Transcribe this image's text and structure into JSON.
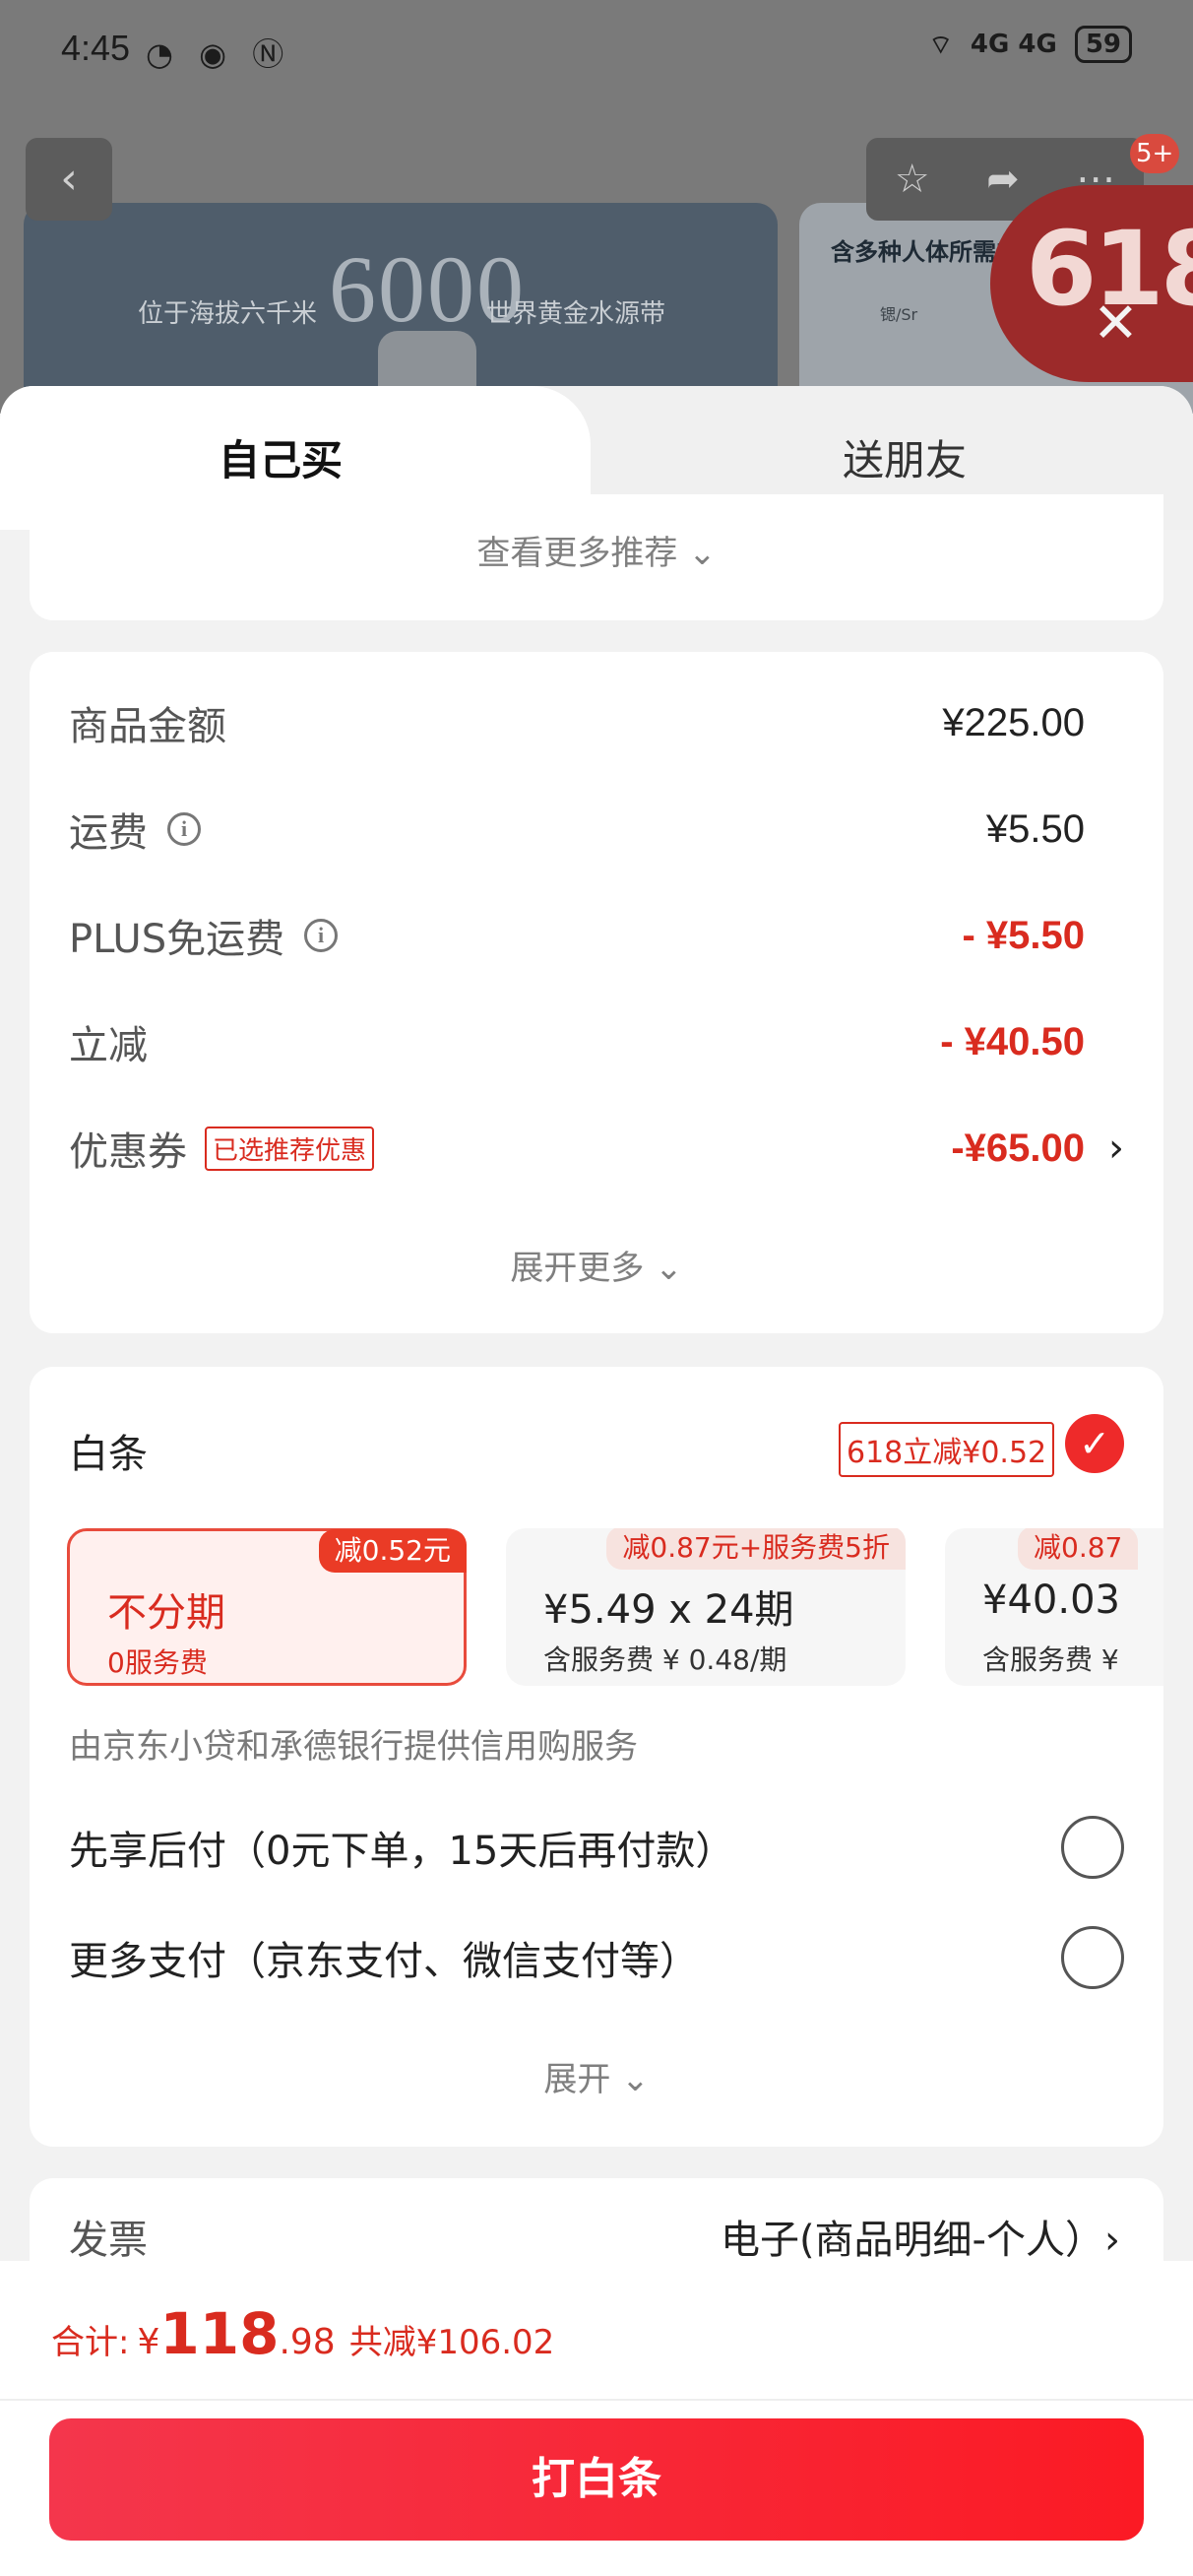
{
  "status_bar": {
    "time": "4:45",
    "network": "4G 4G",
    "battery": "59"
  },
  "background": {
    "banner_text_left": "位于海拔六千米",
    "banner_big_number": "6000",
    "banner_text_right": "世界黄金水源带",
    "card2_heading": "含多种人体所需的",
    "card2_mini": "锶/Sr",
    "message_badge": "5+",
    "promo_number": "618"
  },
  "tabs": {
    "self": "自己买",
    "friend": "送朋友"
  },
  "recommend": {
    "more_label": "查看更多推荐 ⌄"
  },
  "summary": {
    "rows": [
      {
        "label": "商品金额",
        "value": "¥225.00"
      },
      {
        "label": "运费",
        "value": "¥5.50"
      },
      {
        "label": "PLUS免运费",
        "value": "- ¥5.50"
      },
      {
        "label": "立减",
        "value": "- ¥40.50"
      },
      {
        "label": "优惠券",
        "tag": "已选推荐优惠",
        "value": "-¥65.00"
      }
    ],
    "expand_label": "展开更多 ⌄"
  },
  "payment": {
    "title": "白条",
    "promo_tag": "618立减¥0.52",
    "plans": [
      {
        "badge": "减0.52元",
        "title": "不分期",
        "sub": "0服务费"
      },
      {
        "badge": "减0.87元+服务费5折",
        "title": "¥5.49 x 24期",
        "sub": "含服务费 ¥ 0.48/期"
      },
      {
        "badge": "减0.87",
        "title": "¥40.03",
        "sub": "含服务费 ¥"
      }
    ],
    "provider_note": "由京东小贷和承德银行提供信用购服务",
    "options": [
      {
        "label": "先享后付（0元下单，15天后再付款）"
      },
      {
        "label": "更多支付（京东支付、微信支付等）"
      }
    ],
    "expand_label": "展开 ⌄"
  },
  "invoice": {
    "label": "发票",
    "value": "电子(商品明细-个人）›"
  },
  "footer": {
    "total_label": "合计:",
    "currency": "¥",
    "total_int": "118",
    "total_dec": ".98",
    "total_off": "共减¥106.02",
    "cta_label": "打白条"
  },
  "colors": {
    "accent": "#d92b1f",
    "cta_start": "#f4364c",
    "cta_end": "#fb1a24"
  }
}
